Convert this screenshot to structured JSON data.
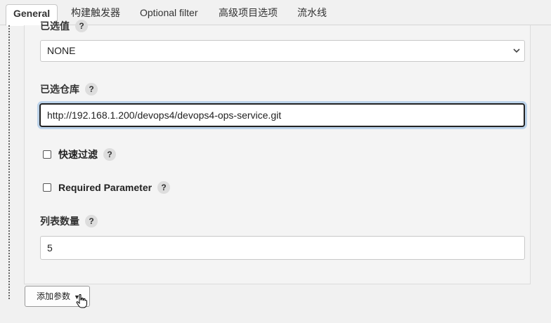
{
  "tabs": [
    {
      "label": "General",
      "active": true
    },
    {
      "label": "构建触发器",
      "active": false
    },
    {
      "label": "Optional filter",
      "active": false
    },
    {
      "label": "高级项目选项",
      "active": false
    },
    {
      "label": "流水线",
      "active": false
    }
  ],
  "form": {
    "selected_value": {
      "label": "已选值",
      "help": "?",
      "value": "NONE"
    },
    "selected_repo": {
      "label": "已选仓库",
      "help": "?",
      "value": "http://192.168.1.200/devops4/devops4-ops-service.git"
    },
    "quick_filter": {
      "label": "快速过滤",
      "help": "?",
      "checked": false
    },
    "required_param": {
      "label": "Required Parameter",
      "help": "?",
      "checked": false
    },
    "list_count": {
      "label": "列表数量",
      "help": "?",
      "value": "5"
    }
  },
  "add_param_button": {
    "label": "添加参数"
  },
  "colors": {
    "focus_ring": "#bcd3ea",
    "panel_bg": "#f4f4f4",
    "help_bg": "#dddddd"
  }
}
